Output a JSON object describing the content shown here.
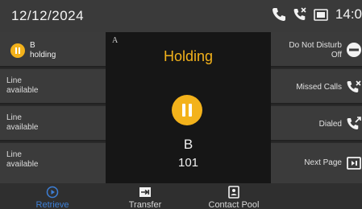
{
  "status_bar": {
    "date": "12/12/2024",
    "time": "14:0"
  },
  "line_keys": [
    {
      "line1": "B",
      "line2": "holding",
      "state": "holding"
    },
    {
      "line1": "Line",
      "line2": "available",
      "state": "idle"
    },
    {
      "line1": "Line",
      "line2": "available",
      "state": "idle"
    },
    {
      "line1": "Line",
      "line2": "available",
      "state": "idle"
    }
  ],
  "call": {
    "account_letter": "A",
    "state": "Holding",
    "name": "B",
    "number": "101"
  },
  "function_keys": [
    {
      "label1": "Do Not Disturb",
      "label2": "Off",
      "icon": "minus-circle-icon"
    },
    {
      "label1": "Missed Calls",
      "label2": "",
      "icon": "missed-call-icon"
    },
    {
      "label1": "Dialed",
      "label2": "",
      "icon": "dialed-call-icon"
    },
    {
      "label1": "Next Page",
      "label2": "",
      "icon": "next-page-icon"
    }
  ],
  "softkeys": [
    {
      "label": "Retrieve",
      "icon": "play-circle-icon",
      "active": true
    },
    {
      "label": "Transfer",
      "icon": "transfer-icon",
      "active": false
    },
    {
      "label": "Contact Pool",
      "icon": "contact-book-icon",
      "active": false
    }
  ],
  "colors": {
    "accent_hold": "#f3b21b",
    "softkey_active": "#3d7fd6"
  }
}
